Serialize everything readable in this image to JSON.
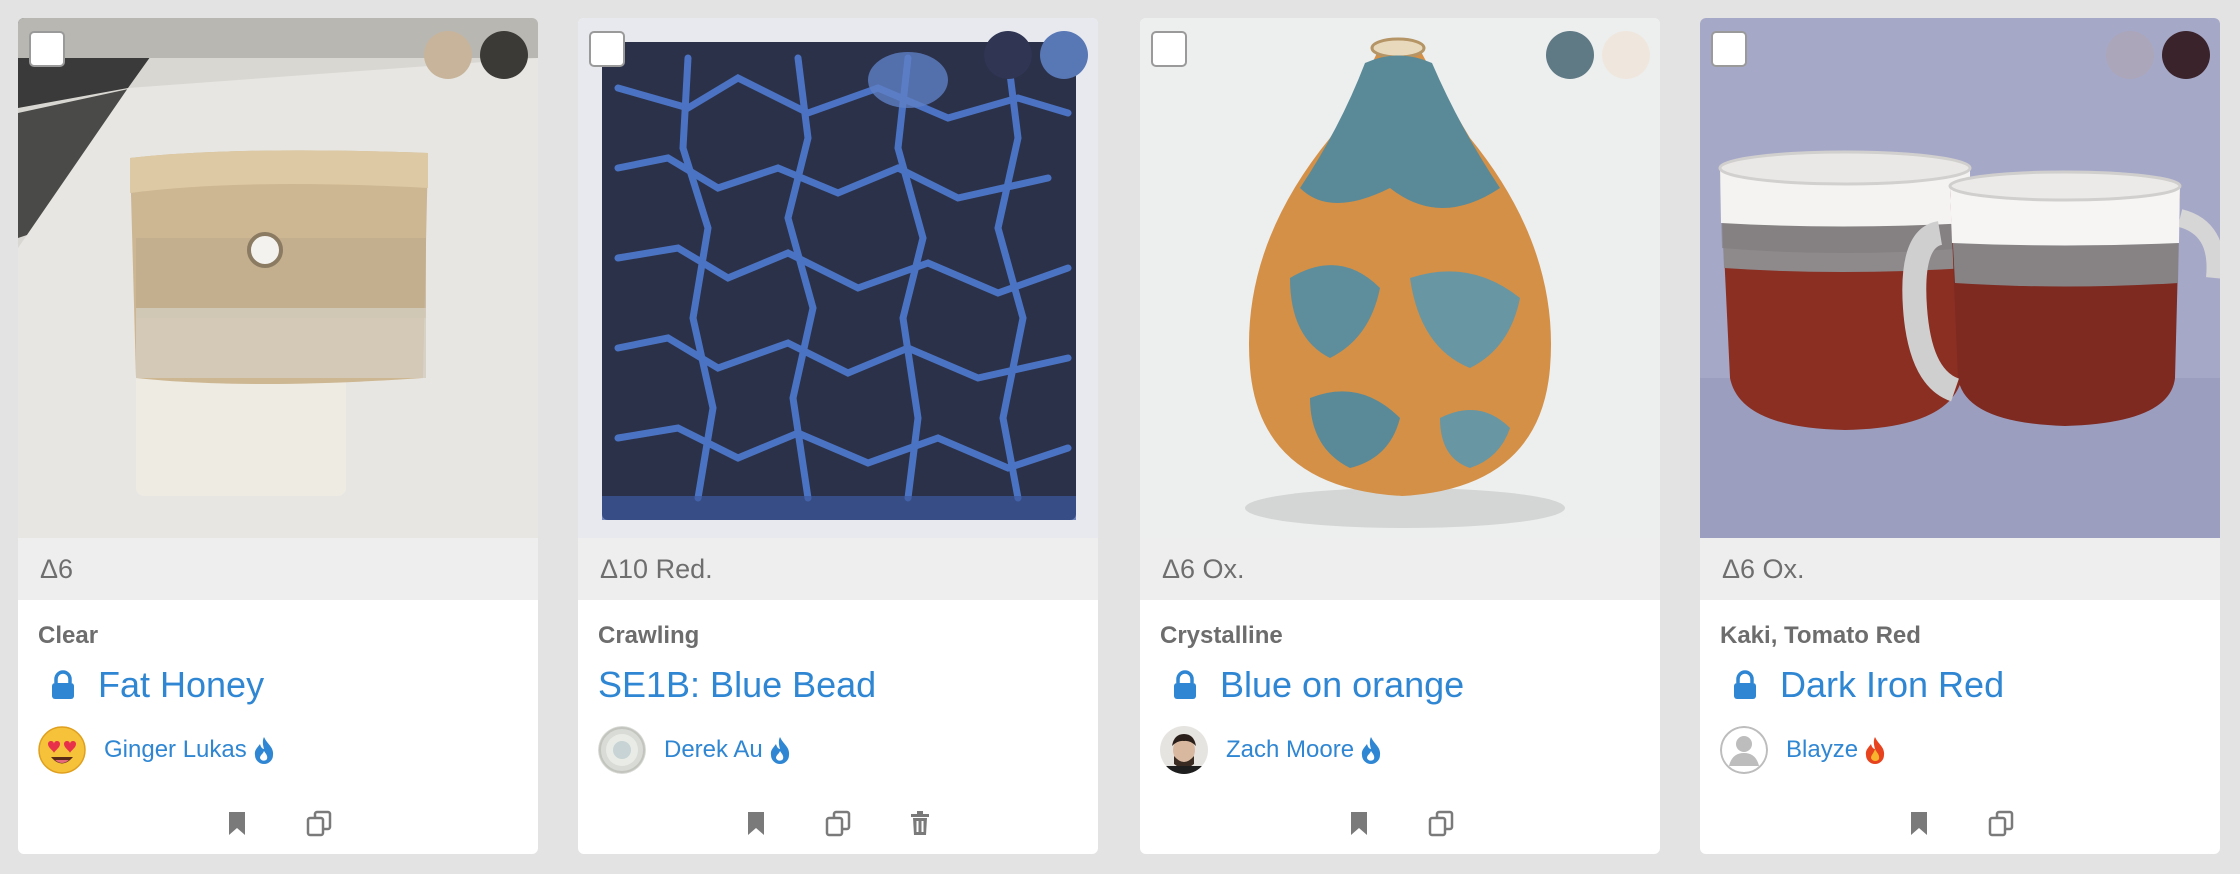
{
  "cards": [
    {
      "cone": "Δ6",
      "category": "Clear",
      "title": "Fat Honey",
      "locked": true,
      "author": "Ginger Lukas",
      "avatar": "heart-eyes-emoji",
      "flame_color": "#2f86d3",
      "swatches": [
        "#c7b49a",
        "#3b3a36"
      ],
      "actions": [
        "bookmark",
        "duplicate"
      ]
    },
    {
      "cone": "Δ10 Red.",
      "category": "Crawling",
      "title": "SE1B: Blue Bead",
      "locked": false,
      "author": "Derek Au",
      "avatar": "pottery-photo",
      "flame_color": "#2f86d3",
      "swatches": [
        "#2f3552",
        "#5877b5"
      ],
      "actions": [
        "bookmark",
        "duplicate",
        "delete"
      ]
    },
    {
      "cone": "Δ6 Ox.",
      "category": "Crystalline",
      "title": "Blue on orange",
      "locked": true,
      "author": "Zach Moore",
      "avatar": "person-photo",
      "flame_color": "#2f86d3",
      "swatches": [
        "#5f7a84",
        "#efe7dd"
      ],
      "actions": [
        "bookmark",
        "duplicate"
      ]
    },
    {
      "cone": "Δ6 Ox.",
      "category": "Kaki, Tomato Red",
      "title": "Dark Iron Red",
      "locked": true,
      "author": "Blayze",
      "avatar": "default-user",
      "flame_color": "#e8431f",
      "swatches": [
        "#aba6b9",
        "#3a232a"
      ],
      "actions": [
        "bookmark",
        "duplicate"
      ]
    }
  ],
  "colors": {
    "link": "#2f86d3",
    "icon": "#7a7a7a"
  }
}
